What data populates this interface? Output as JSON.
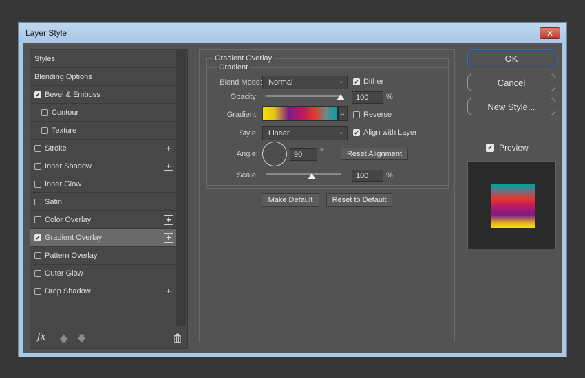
{
  "window": {
    "title": "Layer Style",
    "close_glyph": "✕"
  },
  "styles_list": {
    "items": [
      {
        "label": "Styles",
        "checkbox": false,
        "checked": false,
        "plus": false,
        "selected": false,
        "indent": false
      },
      {
        "label": "Blending Options",
        "checkbox": false,
        "checked": false,
        "plus": false,
        "selected": false,
        "indent": false
      },
      {
        "label": "Bevel & Emboss",
        "checkbox": true,
        "checked": true,
        "plus": false,
        "selected": false,
        "indent": false
      },
      {
        "label": "Contour",
        "checkbox": true,
        "checked": false,
        "plus": false,
        "selected": false,
        "indent": true
      },
      {
        "label": "Texture",
        "checkbox": true,
        "checked": false,
        "plus": false,
        "selected": false,
        "indent": true
      },
      {
        "label": "Stroke",
        "checkbox": true,
        "checked": false,
        "plus": true,
        "selected": false,
        "indent": false
      },
      {
        "label": "Inner Shadow",
        "checkbox": true,
        "checked": false,
        "plus": true,
        "selected": false,
        "indent": false
      },
      {
        "label": "Inner Glow",
        "checkbox": true,
        "checked": false,
        "plus": false,
        "selected": false,
        "indent": false
      },
      {
        "label": "Satin",
        "checkbox": true,
        "checked": false,
        "plus": false,
        "selected": false,
        "indent": false
      },
      {
        "label": "Color Overlay",
        "checkbox": true,
        "checked": false,
        "plus": true,
        "selected": false,
        "indent": false
      },
      {
        "label": "Gradient Overlay",
        "checkbox": true,
        "checked": true,
        "plus": true,
        "selected": true,
        "indent": false
      },
      {
        "label": "Pattern Overlay",
        "checkbox": true,
        "checked": false,
        "plus": false,
        "selected": false,
        "indent": false
      },
      {
        "label": "Outer Glow",
        "checkbox": true,
        "checked": false,
        "plus": false,
        "selected": false,
        "indent": false
      },
      {
        "label": "Drop Shadow",
        "checkbox": true,
        "checked": false,
        "plus": true,
        "selected": false,
        "indent": false
      }
    ],
    "footer": {
      "fx_label": "fx",
      "up_glyph": "🡅",
      "down_glyph": "🡇"
    }
  },
  "gradient_overlay": {
    "section_title": "Gradient Overlay",
    "group_title": "Gradient",
    "blend_mode": {
      "label": "Blend Mode:",
      "value": "Normal"
    },
    "dither": {
      "label": "Dither",
      "checked": true
    },
    "opacity": {
      "label": "Opacity:",
      "value": "100",
      "unit": "%",
      "level": 1.0
    },
    "gradient": {
      "label": "Gradient:"
    },
    "reverse": {
      "label": "Reverse",
      "checked": false
    },
    "style": {
      "label": "Style:",
      "value": "Linear"
    },
    "align_with_layer": {
      "label": "Align with Layer",
      "checked": true
    },
    "angle": {
      "label": "Angle:",
      "value": "90",
      "unit": "°"
    },
    "reset_alignment": "Reset Alignment",
    "scale": {
      "label": "Scale:",
      "value": "100",
      "unit": "%",
      "level": 0.5
    },
    "make_default": "Make Default",
    "reset_to_default": "Reset to Default"
  },
  "actions": {
    "ok": "OK",
    "cancel": "Cancel",
    "new_style": "New Style...",
    "preview": {
      "label": "Preview",
      "checked": true
    }
  }
}
